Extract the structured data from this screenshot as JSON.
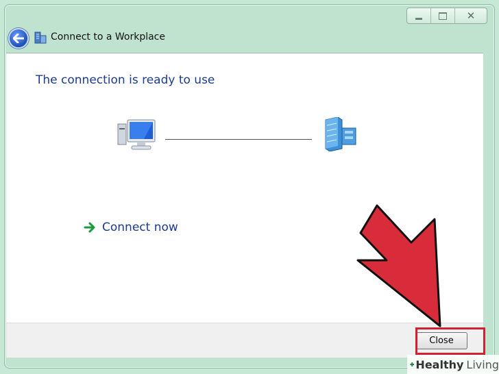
{
  "window": {
    "title": "Connect to a Workplace",
    "caption_buttons": {
      "minimize": "minimize",
      "maximize": "maximize",
      "close": "✕"
    }
  },
  "content": {
    "heading": "The connection is ready to use",
    "connect_now_label": "Connect now"
  },
  "footer": {
    "close_label": "Close"
  },
  "watermark": {
    "brand_bold": "Healthy",
    "brand_light": "Living"
  },
  "colors": {
    "accent_text": "#1b3b8f",
    "window_chrome": "#bfe3cf",
    "annotation_red": "#d12030",
    "connect_arrow_green": "#1a9a3a"
  },
  "icons": {
    "back": "back-arrow-icon",
    "app": "workplace-network-icon",
    "computer": "computer-icon",
    "server": "office-building-server-icon",
    "connect": "green-arrow-icon"
  }
}
